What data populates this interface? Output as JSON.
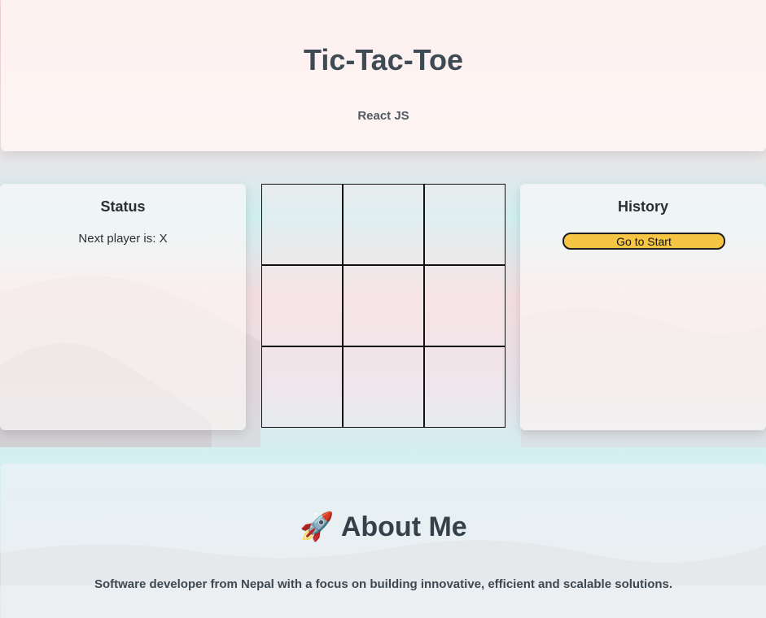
{
  "header": {
    "title": "Tic-Tac-Toe",
    "subtitle": "React JS"
  },
  "status": {
    "title": "Status",
    "text": "Next player is: X"
  },
  "board": {
    "cells": [
      "",
      "",
      "",
      "",
      "",
      "",
      "",
      "",
      ""
    ]
  },
  "history": {
    "title": "History",
    "moves": [
      "Go to Start"
    ]
  },
  "about": {
    "icon": "🚀",
    "title": "About Me",
    "description": "Software developer from Nepal with a focus on building innovative, efficient and scalable solutions."
  },
  "colors": {
    "button": "#f6c544",
    "heading": "#3e4a54",
    "sky": "#cfeef0",
    "pink": "#f3d7d9"
  }
}
